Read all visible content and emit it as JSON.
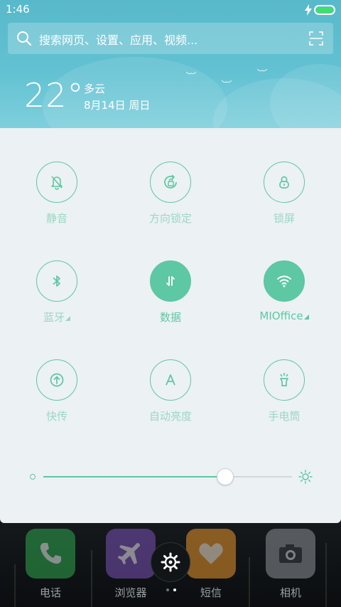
{
  "status_bar": {
    "time": "1:46",
    "battery_level": 1.0,
    "battery_color": "#3ee06b",
    "charging_icon": "lightning-icon"
  },
  "search": {
    "placeholder": "搜索网页、设置、应用、视频...",
    "icon": "search-icon",
    "scan_icon": "scan-icon"
  },
  "weather": {
    "temperature": "22°",
    "condition": "多云",
    "date": "8月14日 周日"
  },
  "quick_settings": {
    "accent_color": "#5ec7a3",
    "tiles": [
      {
        "label": "静音",
        "icon": "bell-off-icon",
        "active": false
      },
      {
        "label": "方向锁定",
        "icon": "rotation-lock-icon",
        "active": false
      },
      {
        "label": "锁屏",
        "icon": "lock-icon",
        "active": false
      },
      {
        "label": "蓝牙",
        "icon": "bluetooth-icon",
        "active": false,
        "expandable": true
      },
      {
        "label": "数据",
        "icon": "mobile-data-icon",
        "active": true
      },
      {
        "label": "MIOffice",
        "icon": "wifi-icon",
        "active": true,
        "expandable": true
      },
      {
        "label": "快传",
        "icon": "quick-transfer-icon",
        "active": false
      },
      {
        "label": "自动亮度",
        "icon": "auto-brightness-icon",
        "active": false
      },
      {
        "label": "手电筒",
        "icon": "flashlight-icon",
        "active": false
      }
    ],
    "brightness": {
      "level": 0.73,
      "min_icon": "brightness-low-icon",
      "max_icon": "brightness-high-icon"
    }
  },
  "dock": {
    "apps": [
      {
        "label": "电话",
        "icon": "phone-icon",
        "color": "#2fa84f"
      },
      {
        "label": "浏览器",
        "icon": "airplane-icon",
        "color": "#7b52b8"
      },
      {
        "label": "短信",
        "icon": "heart-icon",
        "color": "#e8952a"
      },
      {
        "label": "相机",
        "icon": "camera-icon",
        "color": "#8d9296"
      }
    ],
    "settings_icon": "gear-icon",
    "page_indicator": {
      "pages": 2,
      "current": 2
    }
  }
}
